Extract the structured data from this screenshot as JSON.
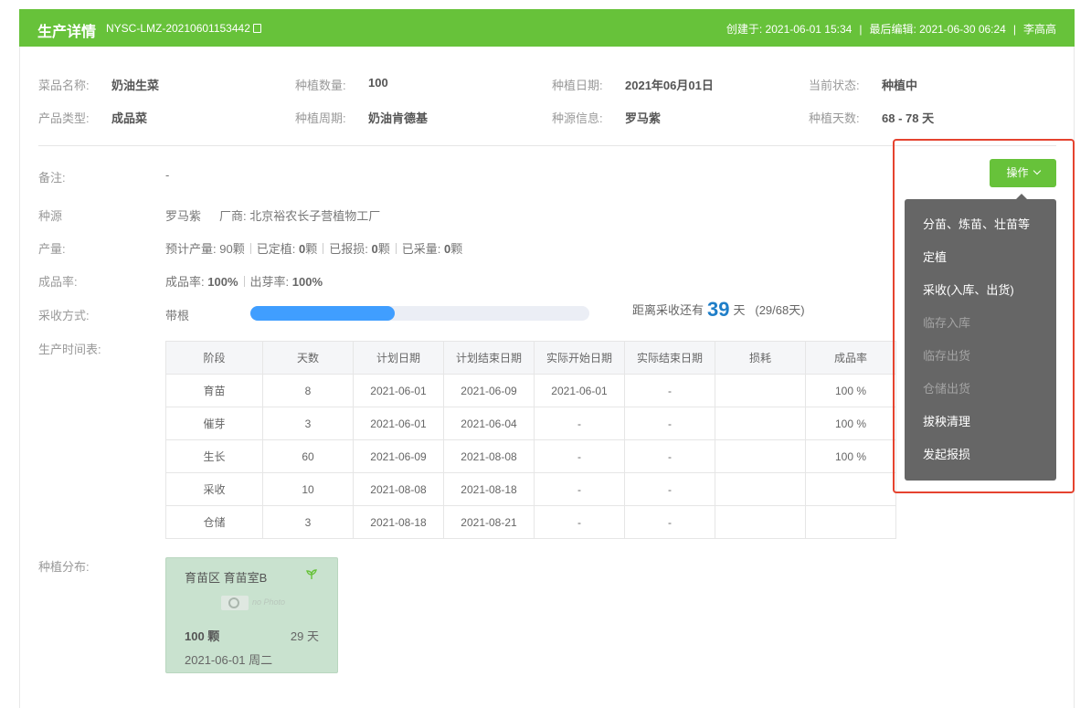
{
  "header": {
    "title": "生产详情",
    "code": "NYSC-LMZ-20210601153442",
    "created": "创建于: 2021-06-01 15:34",
    "edited": "最后编辑: 2021-06-30 06:24",
    "user": "李高高",
    "sep": "|",
    "bg_color": "#67c23a"
  },
  "info": {
    "row1": [
      {
        "label": "菜品名称:",
        "value": "奶油生菜"
      },
      {
        "label": "种植数量:",
        "value": "100"
      },
      {
        "label": "种植日期:",
        "value": "2021年06月01日"
      },
      {
        "label": "当前状态:",
        "value": "种植中"
      }
    ],
    "row2": [
      {
        "label": "产品类型:",
        "value": "成品菜"
      },
      {
        "label": "种植周期:",
        "value": "奶油肯德基"
      },
      {
        "label": "种源信息:",
        "value": "罗马紫"
      },
      {
        "label": "种植天数:",
        "value": "68 - 78 天"
      }
    ]
  },
  "details": {
    "remark_label": "备注:",
    "remark_value": "-",
    "seed_label": "种源",
    "seed_name": "罗马紫",
    "seed_vendor": "厂商: 北京裕农长子营植物工厂",
    "yield_label": "产量:",
    "yield_expected_label": "预计产量:",
    "yield_expected_value": "90颗",
    "yield_planted_label": "已定植:",
    "yield_planted_value": "0",
    "yield_planted_unit": "颗",
    "yield_lost_label": "已报损:",
    "yield_lost_value": "0",
    "yield_lost_unit": "颗",
    "yield_harvest_label": "已采量:",
    "yield_harvest_value": "0",
    "yield_harvest_unit": "颗",
    "rate_label": "成品率:",
    "rate_product_label": "成品率:",
    "rate_product_value": "100%",
    "rate_sprout_label": "出芽率:",
    "rate_sprout_value": "100%",
    "harvest_label": "采收方式:",
    "harvest_value": "带根",
    "progress_fraction": 0.426,
    "countdown_prefix": "距离采收还有",
    "countdown_days": "39",
    "countdown_unit": "天",
    "countdown_note": "(29/68天)",
    "schedule_label": "生产时间表:",
    "distribution_label": "种植分布:"
  },
  "schedule": {
    "headers": [
      "阶段",
      "天数",
      "计划日期",
      "计划结束日期",
      "实际开始日期",
      "实际结束日期",
      "损耗",
      "成品率"
    ],
    "rows": [
      [
        "育苗",
        "8",
        "2021-06-01",
        "2021-06-09",
        "2021-06-01",
        "-",
        "",
        "100 %"
      ],
      [
        "催芽",
        "3",
        "2021-06-01",
        "2021-06-04",
        "-",
        "-",
        "",
        "100 %"
      ],
      [
        "生长",
        "60",
        "2021-06-09",
        "2021-08-08",
        "-",
        "-",
        "",
        "100 %"
      ],
      [
        "采收",
        "10",
        "2021-08-08",
        "2021-08-18",
        "-",
        "-",
        "",
        ""
      ],
      [
        "仓储",
        "3",
        "2021-08-18",
        "2021-08-21",
        "-",
        "-",
        "",
        ""
      ]
    ]
  },
  "plant_card": {
    "name": "育苗区 育苗室B",
    "photo_text": "no Photo",
    "count": "100 颗",
    "days": "29 天",
    "date": "2021-06-01 周二",
    "icon": "sprout-icon",
    "bg_color": "#c9e2cf"
  },
  "operations": {
    "button_label": "操作",
    "menu": [
      {
        "label": "分苗、炼苗、壮苗等",
        "disabled": false
      },
      {
        "label": "定植",
        "disabled": false
      },
      {
        "label": "采收(入库、出货)",
        "disabled": false
      },
      {
        "label": "临存入库",
        "disabled": true
      },
      {
        "label": "临存出货",
        "disabled": true
      },
      {
        "label": "仓储出货",
        "disabled": true
      },
      {
        "label": "拔秧清理",
        "disabled": false
      },
      {
        "label": "发起报损",
        "disabled": false
      }
    ],
    "highlight_color": "#e5432f"
  }
}
